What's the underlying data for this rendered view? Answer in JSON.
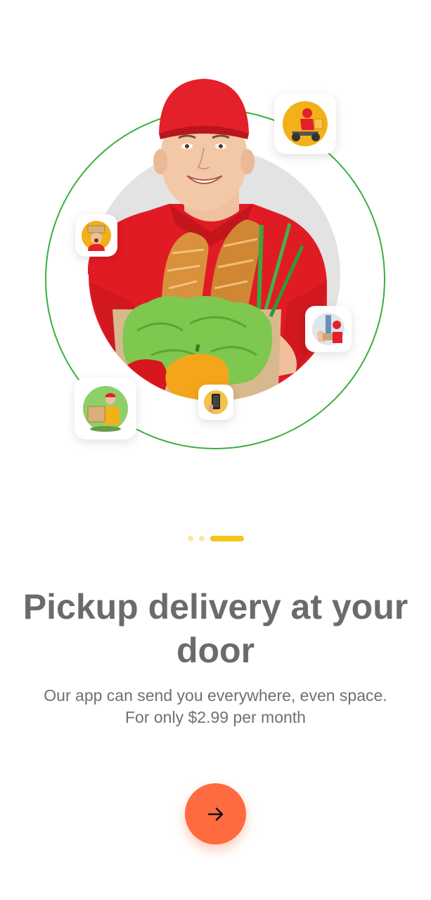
{
  "onboarding": {
    "title": "Pickup delivery at your door",
    "description": "Our app can send you everywhere, even space. For only $2.99 per month",
    "page_indicator": {
      "total": 3,
      "active_index": 2
    },
    "next_button": {
      "icon": "arrow-right-icon"
    }
  },
  "hero": {
    "main_image": "delivery-man-with-groceries",
    "thumbnails": [
      "scooter-courier-thumbnail",
      "courier-with-boxes-thumbnail",
      "door-delivery-thumbnail",
      "pizza-courier-thumbnail",
      "phone-in-hand-thumbnail"
    ]
  },
  "colors": {
    "accent": "#ff6b40",
    "indicator_active": "#f5c518",
    "indicator_inactive": "#fbe7a4",
    "orbit_line": "#3cae3f",
    "text_title": "#6b6b6b",
    "text_body": "#707070",
    "uniform_red": "#e11b24"
  }
}
